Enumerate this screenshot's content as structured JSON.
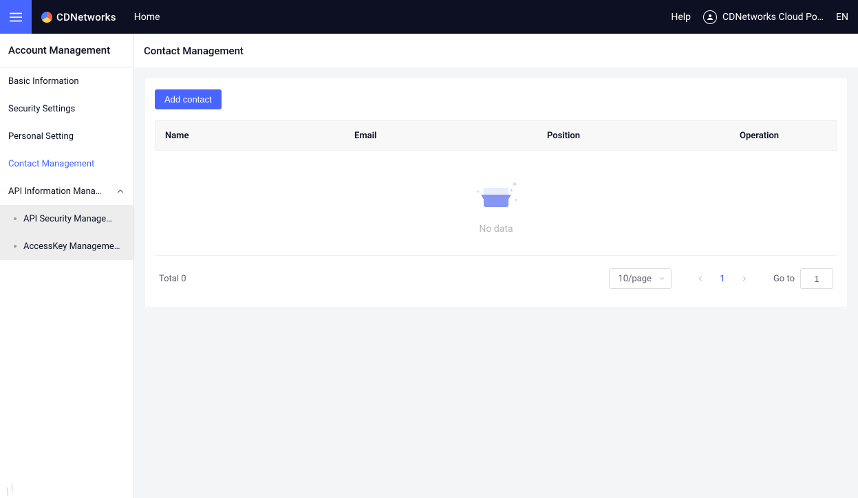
{
  "topbar": {
    "brand": "CDNetworks",
    "home": "Home",
    "help": "Help",
    "account": "CDNetworks Cloud Po…",
    "lang": "EN"
  },
  "sidebar": {
    "title": "Account Management",
    "items": [
      {
        "label": "Basic Information"
      },
      {
        "label": "Security Settings"
      },
      {
        "label": "Personal Setting"
      },
      {
        "label": "Contact Management",
        "active": true
      },
      {
        "label": "API Information Mana…",
        "expandable": true,
        "children": [
          {
            "label": "API Security Manage…"
          },
          {
            "label": "AccessKey Manageme…"
          }
        ]
      }
    ]
  },
  "page": {
    "title": "Contact Management",
    "add_button": "Add contact",
    "columns": {
      "name": "Name",
      "email": "Email",
      "position": "Position",
      "operation": "Operation"
    },
    "empty_text": "No data"
  },
  "pagination": {
    "total_label": "Total 0",
    "page_size_label": "10/page",
    "current": "1",
    "goto_label": "Go to",
    "goto_value": "1"
  }
}
